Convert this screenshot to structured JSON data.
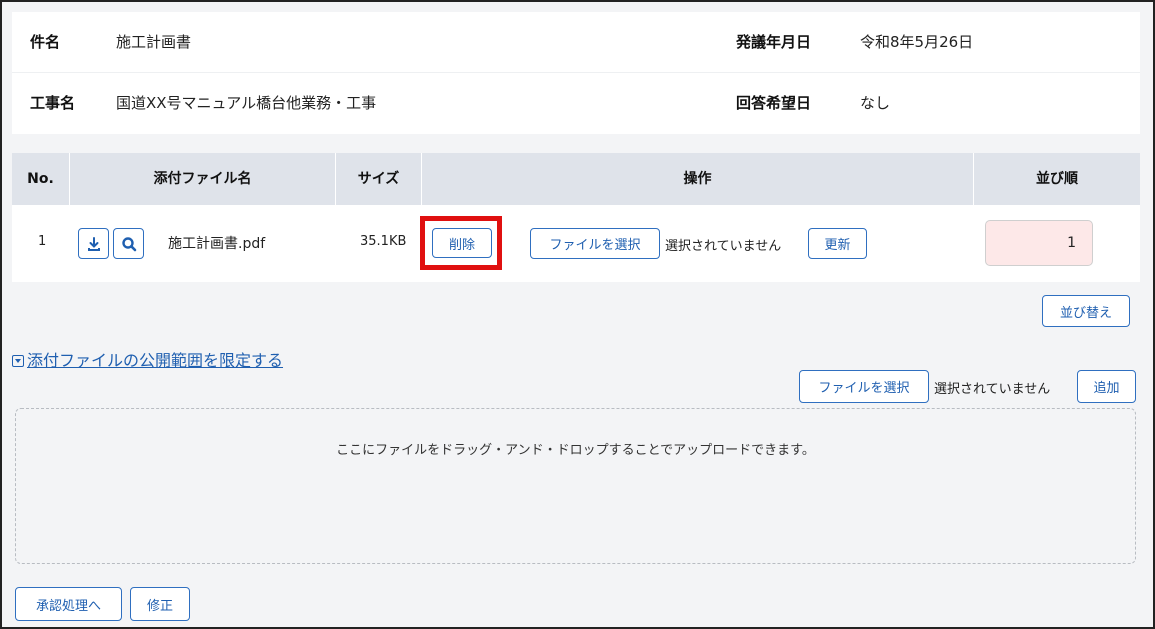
{
  "info": {
    "subject_label": "件名",
    "subject_value": "施工計画書",
    "order_date_label": "発議年月日",
    "order_date_value": "令和8年5月26日",
    "project_label": "工事名",
    "project_value": "国道XX号マニュアル橋台他業務・工事",
    "reply_label": "回答希望日",
    "reply_value": "なし"
  },
  "file_table": {
    "headers": {
      "no": "No.",
      "name": "添付ファイル名",
      "size": "サイズ",
      "ops": "操作",
      "order": "並び順"
    },
    "rows": [
      {
        "no": "1",
        "file_name": "施工計画書.pdf",
        "size": "35.1KB",
        "delete_label": "削除",
        "choose_label": "ファイルを選択",
        "no_file_text": "選択されていません",
        "update_label": "更新",
        "order": "1"
      }
    ]
  },
  "sort_button": "並び替え",
  "limit_link": "添付ファイルの公開範囲を限定する",
  "upload": {
    "choose_label": "ファイルを選択",
    "no_file_text": "選択されていません",
    "add_label": "追加",
    "drop_text": "ここにファイルをドラッグ・アンド・ドロップすることでアップロードできます。"
  },
  "footer": {
    "approve_label": "承認処理へ",
    "edit_label": "修正"
  },
  "colors": {
    "accent": "#2f6fc0",
    "highlight": "#e01010",
    "order_bg": "#fde8e8",
    "header_bg": "#dfe3ea"
  }
}
